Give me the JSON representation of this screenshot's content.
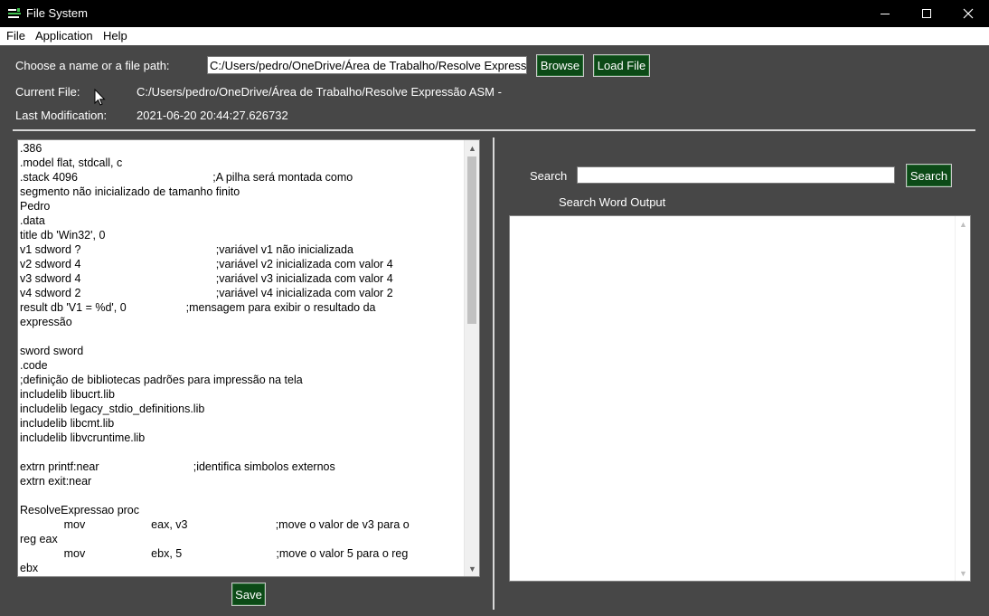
{
  "window": {
    "title": "File System",
    "minimize_symbol": "—",
    "close_symbol": "✕"
  },
  "menu": [
    "File",
    "Application",
    "Help"
  ],
  "file": {
    "choose_label": "Choose a name or a file path:",
    "path_value": "C:/Users/pedro/OneDrive/Área de Trabalho/Resolve Expressão ASM - Pedro",
    "browse_label": "Browse",
    "load_label": "Load File",
    "current_label": "Current File:",
    "current_value": "C:/Users/pedro/OneDrive/Área de Trabalho/Resolve Expressão ASM -",
    "modified_label": "Last Modification:",
    "modified_value": "2021-06-20 20:44:27.626732"
  },
  "editor": {
    "lines": [
      ".386",
      ".model flat, stdcall, c",
      ".stack 4096                                           ;A pilha será montada como",
      "segmento não inicializado de tamanho finito",
      "Pedro",
      ".data",
      "title db 'Win32', 0",
      "v1 sdword ?                                           ;variável v1 não inicializada",
      "v2 sdword 4                                           ;variável v2 inicializada com valor 4",
      "v3 sdword 4                                           ;variável v3 inicializada com valor 4",
      "v4 sdword 2                                           ;variável v4 inicializada com valor 2",
      "result db 'V1 = %d', 0                   ;mensagem para exibir o resultado da",
      "expressão",
      "",
      "sword sword",
      ".code",
      ";definição de bibliotecas padrões para impressão na tela",
      "includelib libucrt.lib",
      "includelib legacy_stdio_definitions.lib",
      "includelib libcmt.lib",
      "includelib libvcruntime.lib",
      "",
      "extrn printf:near                              ;identifica simbolos externos",
      "extrn exit:near",
      "",
      "ResolveExpressao proc",
      "              mov                     eax, v3                            ;move o valor de v3 para o",
      "reg eax",
      "              mov                     ebx, 5                              ;move o valor 5 para o reg",
      "ebx"
    ],
    "save_label": "Save"
  },
  "search": {
    "label": "Search",
    "input_value": "",
    "button_label": "Search",
    "output_label": "Search Word Output"
  },
  "icons": {
    "scroll_up": "▲",
    "scroll_down": "▼"
  },
  "colors": {
    "background": "#474747",
    "button_green": "#0c4a17"
  }
}
